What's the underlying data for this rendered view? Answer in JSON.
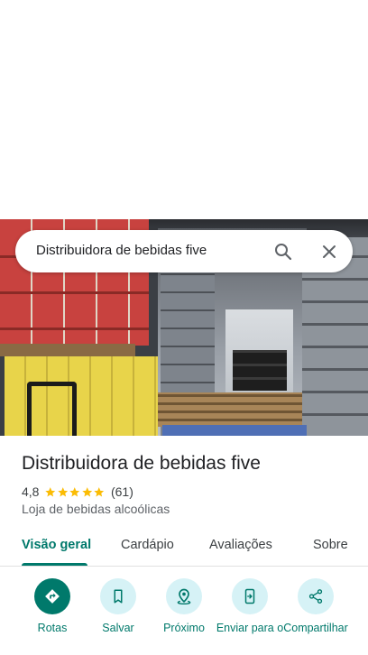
{
  "search": {
    "query": "Distribuidora de bebidas five"
  },
  "place": {
    "name": "Distribuidora de bebidas five",
    "rating": "4,8",
    "stars": 5,
    "review_count": "(61)",
    "category": "Loja de bebidas alcoólicas"
  },
  "tabs": [
    {
      "label": "Visão geral",
      "active": true
    },
    {
      "label": "Cardápio",
      "active": false
    },
    {
      "label": "Avaliações",
      "active": false
    },
    {
      "label": "Sobre",
      "active": false
    }
  ],
  "actions": [
    {
      "label": "Rotas",
      "icon": "directions-icon"
    },
    {
      "label": "Salvar",
      "icon": "bookmark-icon"
    },
    {
      "label": "Próximo",
      "icon": "nearby-icon"
    },
    {
      "label": "Enviar para o",
      "icon": "send-to-phone-icon"
    },
    {
      "label": "Compartilhar",
      "icon": "share-icon"
    }
  ],
  "colors": {
    "accent": "#00796b",
    "star": "#fbbc04",
    "action_bg": "#d6f2f6"
  }
}
